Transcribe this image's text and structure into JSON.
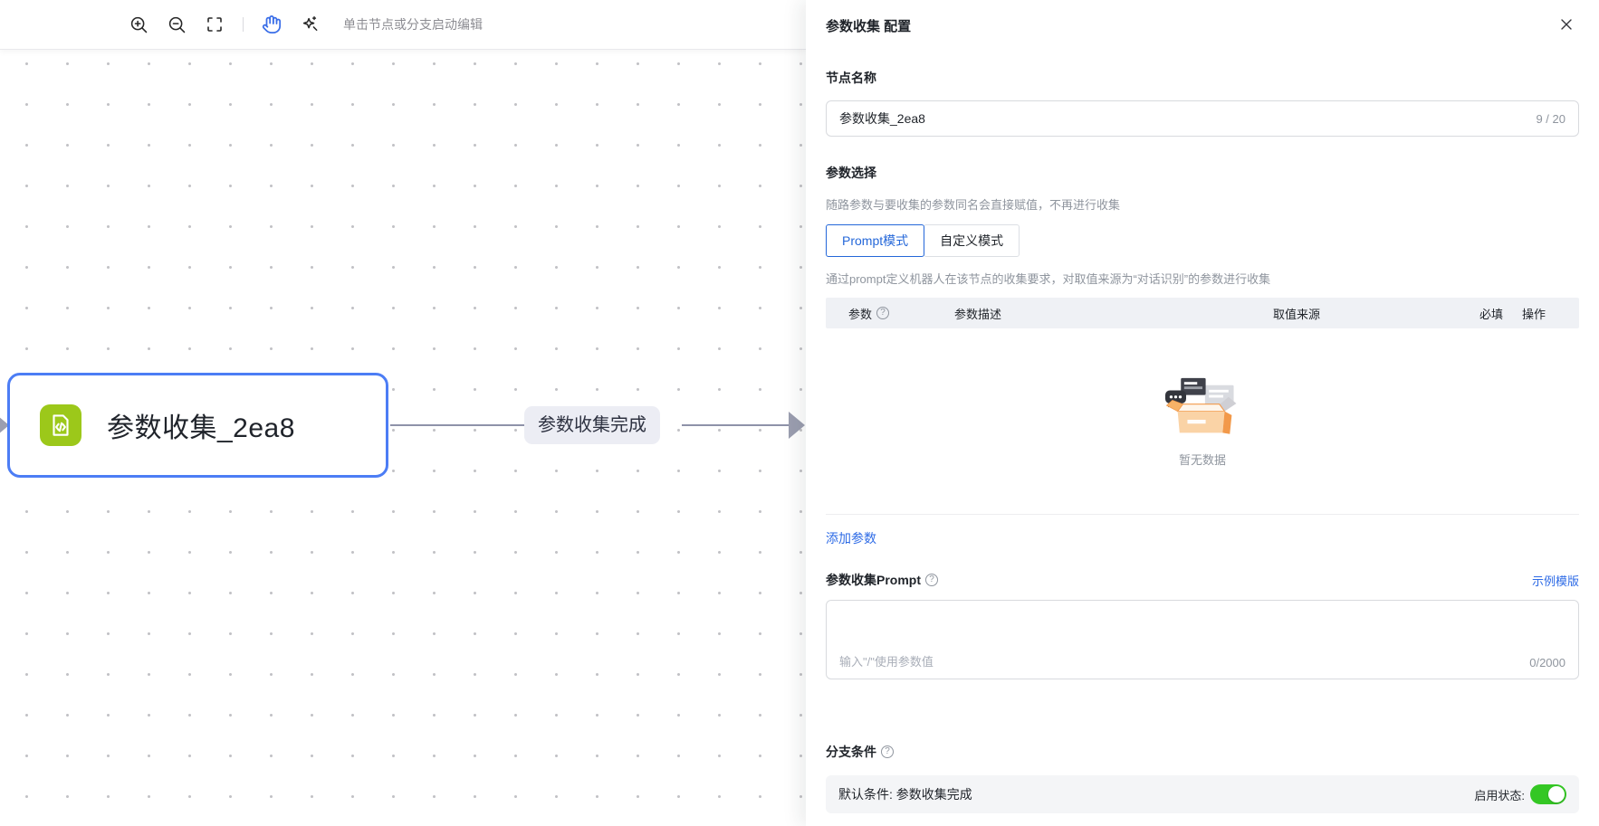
{
  "canvas": {
    "toolbar": {
      "hint": "单击节点或分支启动编辑",
      "icons": [
        "zoom-in",
        "zoom-out",
        "fit-view",
        "hand",
        "magic-wand"
      ]
    },
    "node": {
      "title": "参数收集_2ea8",
      "icon": "code-document-icon"
    },
    "edge": {
      "label": "参数收集完成"
    }
  },
  "panel": {
    "title": "参数收集 配置",
    "close_icon": "close-icon",
    "node_name": {
      "label": "节点名称",
      "value": "参数收集_2ea8",
      "counter": "9 / 20"
    },
    "param_select": {
      "label": "参数选择",
      "hint": "随路参数与要收集的参数同名会直接赋值，不再进行收集",
      "tabs": [
        {
          "label": "Prompt模式",
          "active": true
        },
        {
          "label": "自定义模式",
          "active": false
        }
      ],
      "mode_hint": "通过prompt定义机器人在该节点的收集要求，对取值来源为“对话识别”的参数进行收集",
      "table_headers": [
        "参数",
        "参数描述",
        "取值来源",
        "必填",
        "操作"
      ],
      "empty_text": "暂无数据",
      "add_link": "添加参数"
    },
    "prompt": {
      "label": "参数收集Prompt",
      "template_link": "示例模版",
      "placeholder": "输入\"/\"使用参数值",
      "counter": "0/2000"
    },
    "branch": {
      "label": "分支条件",
      "default_text": "默认条件: 参数收集完成",
      "enable_label": "启用状态:",
      "enabled": true
    }
  },
  "colors": {
    "accent_blue": "#2e6be6",
    "node_border_blue": "#4c7df5",
    "icon_green": "#9cc81a",
    "toggle_green": "#34c724",
    "edge_gray": "#8e92a9"
  }
}
